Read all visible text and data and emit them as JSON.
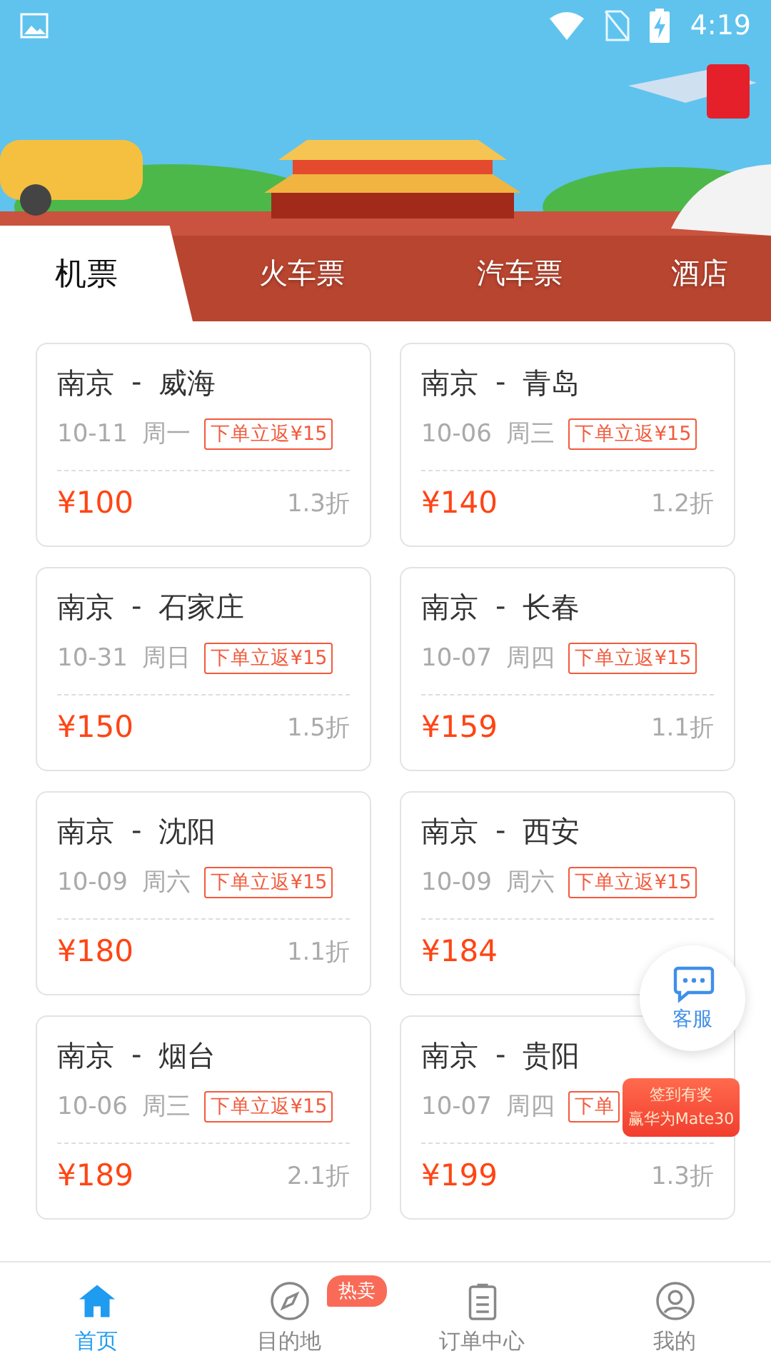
{
  "status_bar": {
    "time": "4:19"
  },
  "tabs": [
    {
      "label": "机票",
      "selected": true
    },
    {
      "label": "火车票",
      "selected": false
    },
    {
      "label": "汽车票",
      "selected": false
    },
    {
      "label": "酒店",
      "selected": false
    }
  ],
  "deals": [
    {
      "route_from": "南京",
      "route_sep": "-",
      "route_to": "威海",
      "date": "10-11",
      "weekday": "周一",
      "tag": "下单立返¥15",
      "price": "¥100",
      "discount": "1.3折"
    },
    {
      "route_from": "南京",
      "route_sep": "-",
      "route_to": "青岛",
      "date": "10-06",
      "weekday": "周三",
      "tag": "下单立返¥15",
      "price": "¥140",
      "discount": "1.2折"
    },
    {
      "route_from": "南京",
      "route_sep": "-",
      "route_to": "石家庄",
      "date": "10-31",
      "weekday": "周日",
      "tag": "下单立返¥15",
      "price": "¥150",
      "discount": "1.5折"
    },
    {
      "route_from": "南京",
      "route_sep": "-",
      "route_to": "长春",
      "date": "10-07",
      "weekday": "周四",
      "tag": "下单立返¥15",
      "price": "¥159",
      "discount": "1.1折"
    },
    {
      "route_from": "南京",
      "route_sep": "-",
      "route_to": "沈阳",
      "date": "10-09",
      "weekday": "周六",
      "tag": "下单立返¥15",
      "price": "¥180",
      "discount": "1.1折"
    },
    {
      "route_from": "南京",
      "route_sep": "-",
      "route_to": "西安",
      "date": "10-09",
      "weekday": "周六",
      "tag": "下单立返¥15",
      "price": "¥184"
    },
    {
      "route_from": "南京",
      "route_sep": "-",
      "route_to": "烟台",
      "date": "10-06",
      "weekday": "周三",
      "tag": "下单立返¥15",
      "price": "¥189",
      "discount": "2.1折"
    },
    {
      "route_from": "南京",
      "route_sep": "-",
      "route_to": "贵阳",
      "date": "10-07",
      "weekday": "周四",
      "tag": "下单",
      "price": "¥199",
      "discount": "1.3折"
    }
  ],
  "service_button": {
    "label": "客服"
  },
  "promo": {
    "line_1": "签到有奖",
    "line_2": "赢华为Mate30"
  },
  "nav": [
    {
      "label": "首页",
      "selected": true
    },
    {
      "label": "目的地",
      "selected": false,
      "badge": "热卖"
    },
    {
      "label": "订单中心",
      "selected": false
    },
    {
      "label": "我的",
      "selected": false
    }
  ]
}
